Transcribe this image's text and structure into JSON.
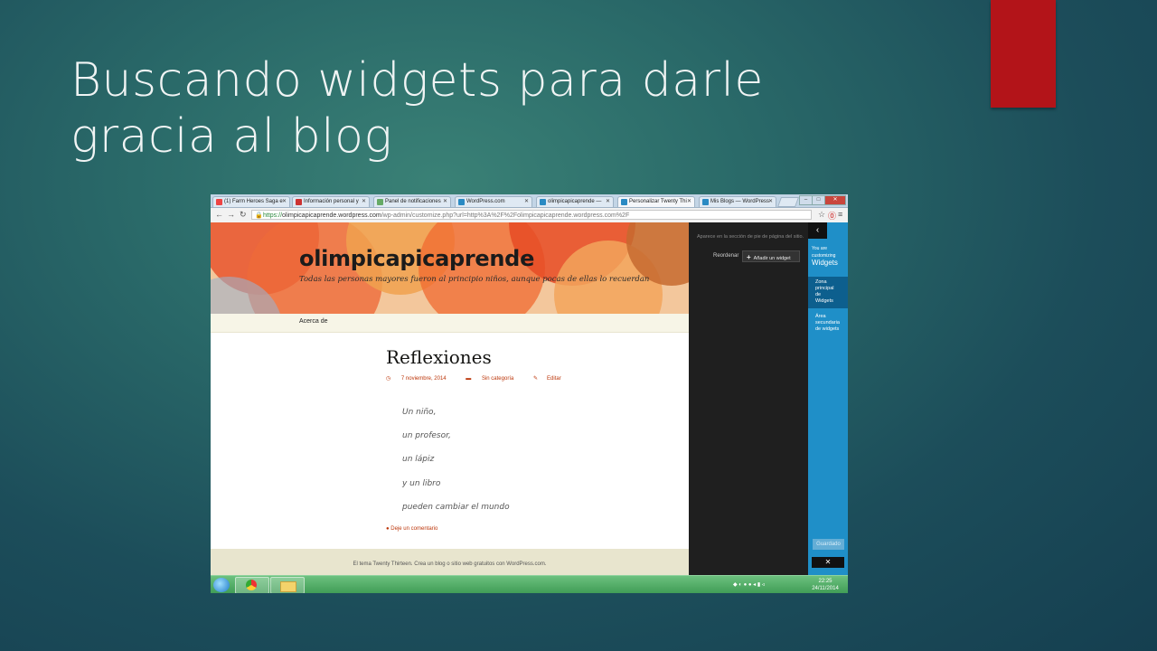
{
  "slide": {
    "title": "Buscando widgets para darle gracia al blog",
    "accent_color": "#b31419"
  },
  "browser": {
    "tabs": [
      {
        "label": "(1) Farm Heroes Saga e",
        "fav_color": "#e44"
      },
      {
        "label": "Información personal y",
        "fav_color": "#c33"
      },
      {
        "label": "Panel de notificaciones",
        "fav_color": "#6a6"
      },
      {
        "label": "WordPress.com",
        "fav_color": "#2a8ac3"
      },
      {
        "label": "olimpicapicaprende —",
        "fav_color": "#2a8ac3"
      },
      {
        "label": "Personalizar Twenty Thi",
        "fav_color": "#2a8ac3"
      },
      {
        "label": "Mis Blogs — WordPress",
        "fav_color": "#2a8ac3"
      }
    ],
    "url_https": "https://",
    "url_host": "olimpicapicaprende.wordpress.com",
    "url_rest": "/wp-admin/customize.php?url=http%3A%2F%2Folimpicapicaprende.wordpress.com%2F"
  },
  "site": {
    "title": "olimpicapicaprende",
    "description": "Todas las personas mayores fueron al principio niños, aunque pocas de ellas lo recuerdan",
    "nav": [
      "Acerca de"
    ]
  },
  "post": {
    "title": "Reflexiones",
    "date": "7 noviembre, 2014",
    "category": "Sin categoría",
    "edit": "Editar",
    "verses": [
      "Un niño,",
      "un profesor,",
      "un lápiz",
      "y un libro",
      "pueden cambiar el mundo"
    ],
    "comment_link": "Deje un comentario"
  },
  "footer": {
    "text": "El tema Twenty Thirteen. Crea un blog o sitio web gratuitos con WordPress.com."
  },
  "widgets_panel": {
    "description": "Aparece en la sección de pie de página del sitio.",
    "reorder_label": "Reordenar",
    "add_widget_label": "Añadir un widget"
  },
  "customizer": {
    "you_are": "You are",
    "customizing": "customizing",
    "section": "Widgets",
    "zone_primary": "Zona principal de Widgets",
    "area_secondary": "Área secundaria de widgets",
    "saved_label": "Guardado",
    "close_label": "✕"
  },
  "taskbar": {
    "time": "22:25",
    "date": "24/11/2014"
  }
}
